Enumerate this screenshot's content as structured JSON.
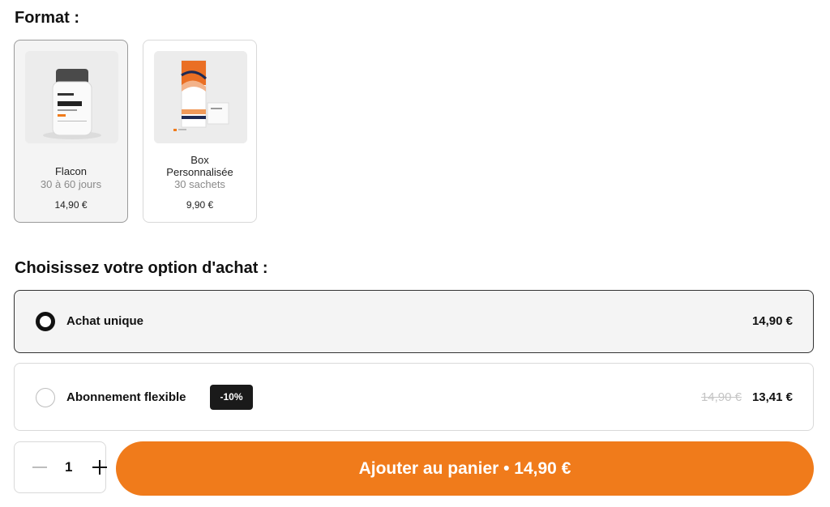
{
  "format": {
    "title": "Format :",
    "cards": [
      {
        "name": "Flacon",
        "subtitle": "30 à 60 jours",
        "price": "14,90 €",
        "selected": true,
        "image": "product-bottle"
      },
      {
        "name_line1": "Box",
        "name_line2": "Personnalisée",
        "subtitle": "30 sachets",
        "price": "9,90 €",
        "selected": false,
        "image": "product-box"
      }
    ]
  },
  "purchase": {
    "title": "Choisissez votre option d'achat :",
    "options": [
      {
        "label": "Achat unique",
        "price": "14,90 €",
        "selected": true
      },
      {
        "label": "Abonnement flexible",
        "badge": "-10%",
        "old_price": "14,90 €",
        "price": "13,41 €",
        "selected": false
      }
    ]
  },
  "cart": {
    "quantity": "1",
    "button_label": "Ajouter au panier • 14,90 €"
  },
  "colors": {
    "accent": "#f07b1b",
    "badge_bg": "#1a1a1a",
    "selected_bg": "#f4f4f4"
  }
}
